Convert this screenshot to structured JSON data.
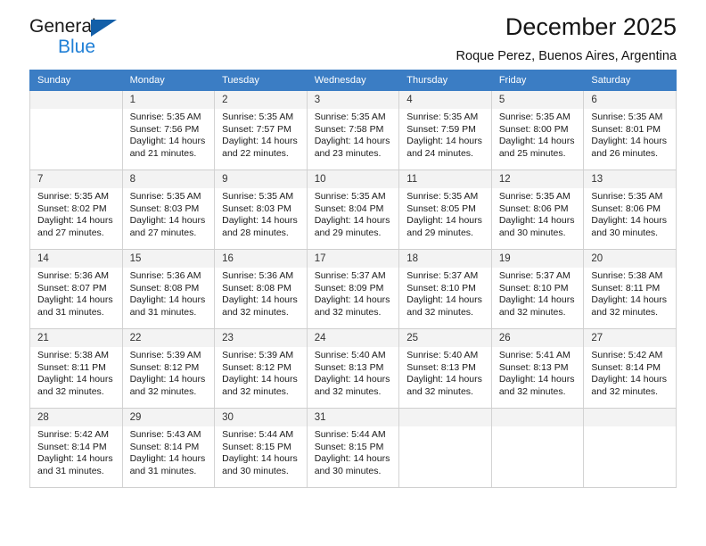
{
  "brand": {
    "name_top": "General",
    "name_bottom": "Blue",
    "accent_color": "#1f7fd6",
    "triangle_color": "#135fa8"
  },
  "header": {
    "title": "December 2025",
    "subtitle": "Roque Perez, Buenos Aires, Argentina"
  },
  "calendar": {
    "header_bg": "#3b7dc4",
    "header_text_color": "#ffffff",
    "daynum_bg": "#f3f3f3",
    "weekday_headers": [
      "Sunday",
      "Monday",
      "Tuesday",
      "Wednesday",
      "Thursday",
      "Friday",
      "Saturday"
    ],
    "weeks": [
      [
        {
          "day": "",
          "lines": []
        },
        {
          "day": "1",
          "lines": [
            "Sunrise: 5:35 AM",
            "Sunset: 7:56 PM",
            "Daylight: 14 hours",
            "and 21 minutes."
          ]
        },
        {
          "day": "2",
          "lines": [
            "Sunrise: 5:35 AM",
            "Sunset: 7:57 PM",
            "Daylight: 14 hours",
            "and 22 minutes."
          ]
        },
        {
          "day": "3",
          "lines": [
            "Sunrise: 5:35 AM",
            "Sunset: 7:58 PM",
            "Daylight: 14 hours",
            "and 23 minutes."
          ]
        },
        {
          "day": "4",
          "lines": [
            "Sunrise: 5:35 AM",
            "Sunset: 7:59 PM",
            "Daylight: 14 hours",
            "and 24 minutes."
          ]
        },
        {
          "day": "5",
          "lines": [
            "Sunrise: 5:35 AM",
            "Sunset: 8:00 PM",
            "Daylight: 14 hours",
            "and 25 minutes."
          ]
        },
        {
          "day": "6",
          "lines": [
            "Sunrise: 5:35 AM",
            "Sunset: 8:01 PM",
            "Daylight: 14 hours",
            "and 26 minutes."
          ]
        }
      ],
      [
        {
          "day": "7",
          "lines": [
            "Sunrise: 5:35 AM",
            "Sunset: 8:02 PM",
            "Daylight: 14 hours",
            "and 27 minutes."
          ]
        },
        {
          "day": "8",
          "lines": [
            "Sunrise: 5:35 AM",
            "Sunset: 8:03 PM",
            "Daylight: 14 hours",
            "and 27 minutes."
          ]
        },
        {
          "day": "9",
          "lines": [
            "Sunrise: 5:35 AM",
            "Sunset: 8:03 PM",
            "Daylight: 14 hours",
            "and 28 minutes."
          ]
        },
        {
          "day": "10",
          "lines": [
            "Sunrise: 5:35 AM",
            "Sunset: 8:04 PM",
            "Daylight: 14 hours",
            "and 29 minutes."
          ]
        },
        {
          "day": "11",
          "lines": [
            "Sunrise: 5:35 AM",
            "Sunset: 8:05 PM",
            "Daylight: 14 hours",
            "and 29 minutes."
          ]
        },
        {
          "day": "12",
          "lines": [
            "Sunrise: 5:35 AM",
            "Sunset: 8:06 PM",
            "Daylight: 14 hours",
            "and 30 minutes."
          ]
        },
        {
          "day": "13",
          "lines": [
            "Sunrise: 5:35 AM",
            "Sunset: 8:06 PM",
            "Daylight: 14 hours",
            "and 30 minutes."
          ]
        }
      ],
      [
        {
          "day": "14",
          "lines": [
            "Sunrise: 5:36 AM",
            "Sunset: 8:07 PM",
            "Daylight: 14 hours",
            "and 31 minutes."
          ]
        },
        {
          "day": "15",
          "lines": [
            "Sunrise: 5:36 AM",
            "Sunset: 8:08 PM",
            "Daylight: 14 hours",
            "and 31 minutes."
          ]
        },
        {
          "day": "16",
          "lines": [
            "Sunrise: 5:36 AM",
            "Sunset: 8:08 PM",
            "Daylight: 14 hours",
            "and 32 minutes."
          ]
        },
        {
          "day": "17",
          "lines": [
            "Sunrise: 5:37 AM",
            "Sunset: 8:09 PM",
            "Daylight: 14 hours",
            "and 32 minutes."
          ]
        },
        {
          "day": "18",
          "lines": [
            "Sunrise: 5:37 AM",
            "Sunset: 8:10 PM",
            "Daylight: 14 hours",
            "and 32 minutes."
          ]
        },
        {
          "day": "19",
          "lines": [
            "Sunrise: 5:37 AM",
            "Sunset: 8:10 PM",
            "Daylight: 14 hours",
            "and 32 minutes."
          ]
        },
        {
          "day": "20",
          "lines": [
            "Sunrise: 5:38 AM",
            "Sunset: 8:11 PM",
            "Daylight: 14 hours",
            "and 32 minutes."
          ]
        }
      ],
      [
        {
          "day": "21",
          "lines": [
            "Sunrise: 5:38 AM",
            "Sunset: 8:11 PM",
            "Daylight: 14 hours",
            "and 32 minutes."
          ]
        },
        {
          "day": "22",
          "lines": [
            "Sunrise: 5:39 AM",
            "Sunset: 8:12 PM",
            "Daylight: 14 hours",
            "and 32 minutes."
          ]
        },
        {
          "day": "23",
          "lines": [
            "Sunrise: 5:39 AM",
            "Sunset: 8:12 PM",
            "Daylight: 14 hours",
            "and 32 minutes."
          ]
        },
        {
          "day": "24",
          "lines": [
            "Sunrise: 5:40 AM",
            "Sunset: 8:13 PM",
            "Daylight: 14 hours",
            "and 32 minutes."
          ]
        },
        {
          "day": "25",
          "lines": [
            "Sunrise: 5:40 AM",
            "Sunset: 8:13 PM",
            "Daylight: 14 hours",
            "and 32 minutes."
          ]
        },
        {
          "day": "26",
          "lines": [
            "Sunrise: 5:41 AM",
            "Sunset: 8:13 PM",
            "Daylight: 14 hours",
            "and 32 minutes."
          ]
        },
        {
          "day": "27",
          "lines": [
            "Sunrise: 5:42 AM",
            "Sunset: 8:14 PM",
            "Daylight: 14 hours",
            "and 32 minutes."
          ]
        }
      ],
      [
        {
          "day": "28",
          "lines": [
            "Sunrise: 5:42 AM",
            "Sunset: 8:14 PM",
            "Daylight: 14 hours",
            "and 31 minutes."
          ]
        },
        {
          "day": "29",
          "lines": [
            "Sunrise: 5:43 AM",
            "Sunset: 8:14 PM",
            "Daylight: 14 hours",
            "and 31 minutes."
          ]
        },
        {
          "day": "30",
          "lines": [
            "Sunrise: 5:44 AM",
            "Sunset: 8:15 PM",
            "Daylight: 14 hours",
            "and 30 minutes."
          ]
        },
        {
          "day": "31",
          "lines": [
            "Sunrise: 5:44 AM",
            "Sunset: 8:15 PM",
            "Daylight: 14 hours",
            "and 30 minutes."
          ]
        },
        {
          "day": "",
          "lines": []
        },
        {
          "day": "",
          "lines": []
        },
        {
          "day": "",
          "lines": []
        }
      ]
    ]
  }
}
